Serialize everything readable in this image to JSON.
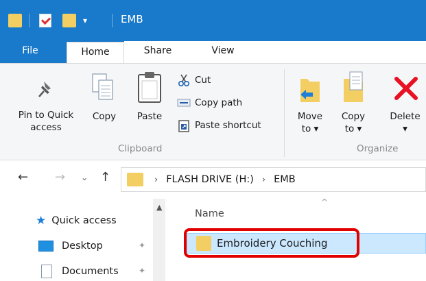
{
  "window": {
    "title": "EMB"
  },
  "tabs": {
    "file": "File",
    "home": "Home",
    "share": "Share",
    "view": "View"
  },
  "ribbon": {
    "pin_label_1": "Pin to Quick",
    "pin_label_2": "access",
    "copy": "Copy",
    "paste": "Paste",
    "cut": "Cut",
    "copy_path": "Copy path",
    "paste_shortcut": "Paste shortcut",
    "move_to_1": "Move",
    "move_to_2": "to ▾",
    "copy_to_1": "Copy",
    "copy_to_2": "to ▾",
    "delete_1": "Delete",
    "delete_2": "▾",
    "group_clipboard": "Clipboard",
    "group_organize": "Organize"
  },
  "address": {
    "segments": [
      "FLASH DRIVE (H:)",
      "EMB"
    ]
  },
  "navpane": {
    "items": [
      {
        "label": "Quick access"
      },
      {
        "label": "Desktop"
      },
      {
        "label": "Documents"
      }
    ]
  },
  "content": {
    "column_name": "Name",
    "rows": [
      {
        "name": "Embroidery Couching",
        "selected": true
      }
    ]
  },
  "colors": {
    "titlebar": "#1979ca",
    "selection": "#cce8ff",
    "highlight": "#e00000",
    "folder": "#f3cf63"
  }
}
